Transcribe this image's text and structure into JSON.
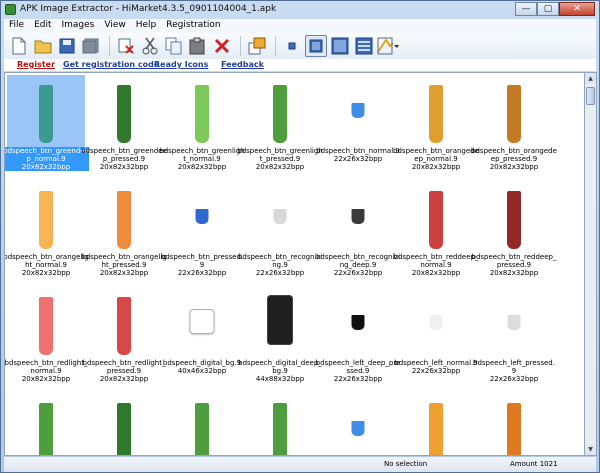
{
  "window": {
    "title": "APK Image Extractor - HiMarket4.3.5_0901104004_1.apk",
    "controls": [
      "—",
      "▢",
      "✕"
    ]
  },
  "menu": [
    "File",
    "Edit",
    "Images",
    "View",
    "Help",
    "Registration"
  ],
  "links": {
    "register": "Register",
    "get_code": "Get registration code",
    "ready_icons": "Ready Icons",
    "feedback": "Feedback"
  },
  "colors": {
    "selection": "#3399ff",
    "link": "#1f3f9f",
    "link_red": "#b31212"
  },
  "toolbar_icons": [
    "new-icon",
    "open-folder-icon",
    "save-icon",
    "save-all-icon",
    "delete-icon",
    "cut-icon",
    "copy-icon",
    "paste-icon",
    "close-icon",
    "export-icon",
    "small-view-icon",
    "medium-view-icon",
    "large-view-icon",
    "list-view-icon",
    "sort-icon"
  ],
  "items": [
    {
      "name": "bdspeech_btn_greendeep_normal.9",
      "size": "20x82x32bpp",
      "color": "#3a9a90",
      "shape": "bar",
      "selected": true
    },
    {
      "name": "bdspeech_btn_greendeep_pressed.9",
      "size": "20x82x32bpp",
      "color": "#2e7a2a",
      "shape": "bar"
    },
    {
      "name": "bdspeech_btn_greenlight_normal.9",
      "size": "20x82x32bpp",
      "color": "#7cc85a",
      "shape": "bar"
    },
    {
      "name": "bdspeech_btn_greenlight_pressed.9",
      "size": "20x82x32bpp",
      "color": "#4e9e3e",
      "shape": "bar"
    },
    {
      "name": "bdspeech_btn_normal.9",
      "size": "22x26x32bpp",
      "color": "#3e8ee8",
      "shape": "small"
    },
    {
      "name": "bdspeech_btn_orangedeep_normal.9",
      "size": "20x82x32bpp",
      "color": "#e0a030",
      "shape": "bar"
    },
    {
      "name": "bdspeech_btn_orangedeep_pressed.9",
      "size": "20x82x32bpp",
      "color": "#c47a22",
      "shape": "bar"
    },
    {
      "name": "bdspeech_btn_orangelight_normal.9",
      "size": "20x82x32bpp",
      "color": "#f7b455",
      "shape": "bar"
    },
    {
      "name": "bdspeech_btn_orangelight_pressed.9",
      "size": "20x82x32bpp",
      "color": "#ee8a3a",
      "shape": "bar"
    },
    {
      "name": "bdspeech_btn_pressed.9",
      "size": "22x26x32bpp",
      "color": "#2f68d0",
      "shape": "small"
    },
    {
      "name": "bdspeech_btn_recognizing.9",
      "size": "22x26x32bpp",
      "color": "#d8d8d8",
      "shape": "small"
    },
    {
      "name": "bdspeech_btn_recognizing_deep.9",
      "size": "22x26x32bpp",
      "color": "#3a3a3a",
      "shape": "small"
    },
    {
      "name": "bdspeech_btn_reddeep_normal.9",
      "size": "20x82x32bpp",
      "color": "#c84040",
      "shape": "bar"
    },
    {
      "name": "bdspeech_btn_reddeep_pressed.9",
      "size": "20x82x32bpp",
      "color": "#932828",
      "shape": "bar"
    },
    {
      "name": "bdspeech_btn_redlight_normal.9",
      "size": "20x82x32bpp",
      "color": "#f07070",
      "shape": "bar"
    },
    {
      "name": "bdspeech_btn_redlight_pressed.9",
      "size": "20x82x32bpp",
      "color": "#d84848",
      "shape": "bar"
    },
    {
      "name": "bdspeech_digital_bg.9",
      "size": "40x46x32bpp",
      "color": "#ffffff",
      "shape": "square"
    },
    {
      "name": "bdspeech_digital_deep_bg.9",
      "size": "44x88x32bpp",
      "color": "#1e1e1e",
      "shape": "phone"
    },
    {
      "name": "bdspeech_left_deep_pressed.9",
      "size": "22x26x32bpp",
      "color": "#101010",
      "shape": "small"
    },
    {
      "name": "bdspeech_left_normal.9",
      "size": "22x26x32bpp",
      "color": "#f0f0f0",
      "shape": "small"
    },
    {
      "name": "bdspeech_left_pressed.9",
      "size": "22x26x32bpp",
      "color": "#dcdcdc",
      "shape": "small"
    },
    {
      "name": "",
      "size": "",
      "color": "#4e9e3e",
      "shape": "bar"
    },
    {
      "name": "",
      "size": "",
      "color": "#2e7a2a",
      "shape": "bar"
    },
    {
      "name": "",
      "size": "",
      "color": "#4e9e3e",
      "shape": "bar"
    },
    {
      "name": "",
      "size": "",
      "color": "#4e9e3e",
      "shape": "bar"
    },
    {
      "name": "",
      "size": "",
      "color": "#3e8ee8",
      "shape": "small"
    },
    {
      "name": "",
      "size": "",
      "color": "#f0a030",
      "shape": "bar"
    },
    {
      "name": "",
      "size": "",
      "color": "#e07a22",
      "shape": "bar"
    }
  ],
  "status": {
    "selection": "No selection",
    "amount": "Amount 1021"
  }
}
